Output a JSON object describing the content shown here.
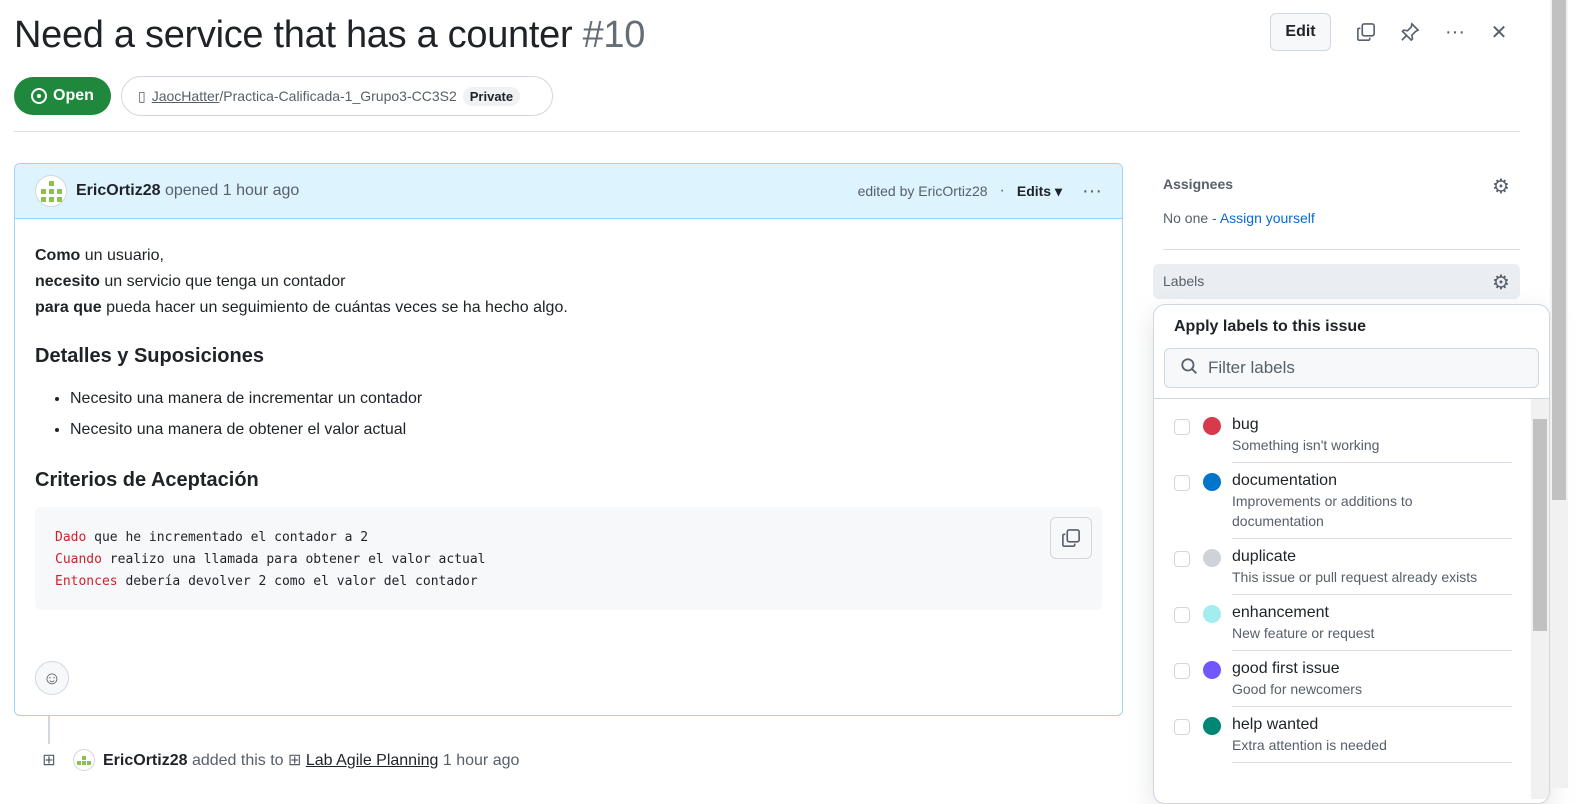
{
  "issue": {
    "title": "Need a service that has a counter",
    "number": "#10",
    "state": "Open",
    "repo_owner": "JaocHatter",
    "repo_name": "/Practica-Calificada-1_Grupo3-CC3S2",
    "visibility": "Private",
    "edit_label": "Edit"
  },
  "comment": {
    "author": "EricOrtiz28",
    "action": "opened 1 hour ago",
    "edited": "edited by EricOrtiz28",
    "edits_label": "Edits",
    "lines": [
      {
        "bold": "Como",
        "text": " un usuario,"
      },
      {
        "bold": "necesito",
        "text": " un servicio que tenga un contador"
      },
      {
        "bold": "para que",
        "text": " pueda hacer un seguimiento de cuántas veces se ha hecho algo."
      }
    ],
    "h_details": "Detalles y Suposiciones",
    "bullets": [
      "Necesito una manera de incrementar un contador",
      "Necesito una manera de obtener el valor actual"
    ],
    "h_criteria": "Criterios de Aceptación",
    "code": [
      {
        "kw": "Dado",
        "text": " que he incrementado el contador a 2"
      },
      {
        "kw": "Cuando",
        "text": " realizo una llamada para obtener el valor actual"
      },
      {
        "kw": "Entonces",
        "text": " debería devolver 2 como el valor del contador"
      }
    ]
  },
  "event": {
    "author": "EricOrtiz28",
    "action": "added this to",
    "project": "Lab Agile Planning",
    "time": "1 hour ago"
  },
  "sidebar": {
    "assignees_title": "Assignees",
    "assignees_value": "No one - ",
    "assign_yourself": "Assign yourself",
    "labels_title": "Labels"
  },
  "labels_popup": {
    "title": "Apply labels to this issue",
    "filter_placeholder": "Filter labels",
    "labels": [
      {
        "name": "bug",
        "description": "Something isn't working",
        "color": "#d73a4a"
      },
      {
        "name": "documentation",
        "description": "Improvements or additions to documentation",
        "color": "#0075ca"
      },
      {
        "name": "duplicate",
        "description": "This issue or pull request already exists",
        "color": "#cfd3d7"
      },
      {
        "name": "enhancement",
        "description": "New feature or request",
        "color": "#a2eeef"
      },
      {
        "name": "good first issue",
        "description": "Good for newcomers",
        "color": "#7057ff"
      },
      {
        "name": "help wanted",
        "description": "Extra attention is needed",
        "color": "#008672"
      }
    ]
  }
}
